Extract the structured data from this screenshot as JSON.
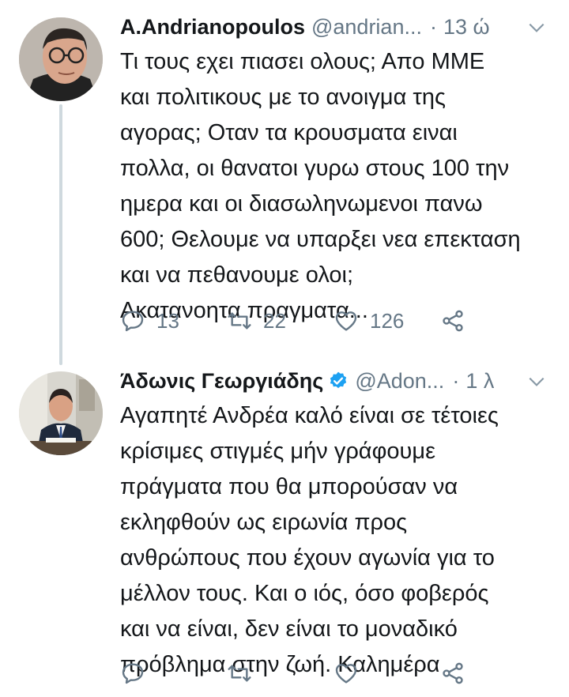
{
  "tweets": [
    {
      "name": "A.Andrianopoulos",
      "handle": "@andrian...",
      "separator": "·",
      "time": "13 ώ",
      "text": "Τι τους εχει πιασει ολους; Απο ΜΜΕ\nκαι πολιτικους με το ανοιγμα της\nαγορας; Οταν τα κρουσματα ειναι\nπολλα, οι θανατοι γυρω στους 100 την\nημερα και οι διασωληνωμενοι πανω\n600; Θελουμε να υπαρξει νεα επεκταση\nκαι να πεθανουμε ολοι;\nΑκατανοητα πραγματα...",
      "replies": "13",
      "retweets": "22",
      "likes": "126",
      "icons": [
        "reply-icon",
        "retweet-icon",
        "like-icon",
        "share-icon"
      ]
    },
    {
      "name": "Άδωνις Γεωργιάδης",
      "handle": "@Adon...",
      "separator": "·",
      "time": "1 λ",
      "verified": true,
      "text": "Αγαπητέ Ανδρέα καλό είναι σε τέτοιες\nκρίσιμες στιγμές μήν γράφουμε\nπράγματα που θα μπορούσαν να\nεκληφθούν ως ειρωνία προς\nανθρώπους που έχουν αγωνία για το\nμέλλον τους. Και ο ιός, όσο φοβερός\nκαι να είναι, δεν είναι το μοναδικό\nπρόβλημα στην ζωή. Καλημέρα",
      "replies": "",
      "retweets": "",
      "likes": "",
      "icons": [
        "reply-icon",
        "retweet-icon",
        "like-icon",
        "share-icon"
      ]
    }
  ],
  "colors": {
    "text": "#14171a",
    "secondary": "#657786",
    "verified": "#1da1f2",
    "thread_line": "#cfd9de"
  }
}
